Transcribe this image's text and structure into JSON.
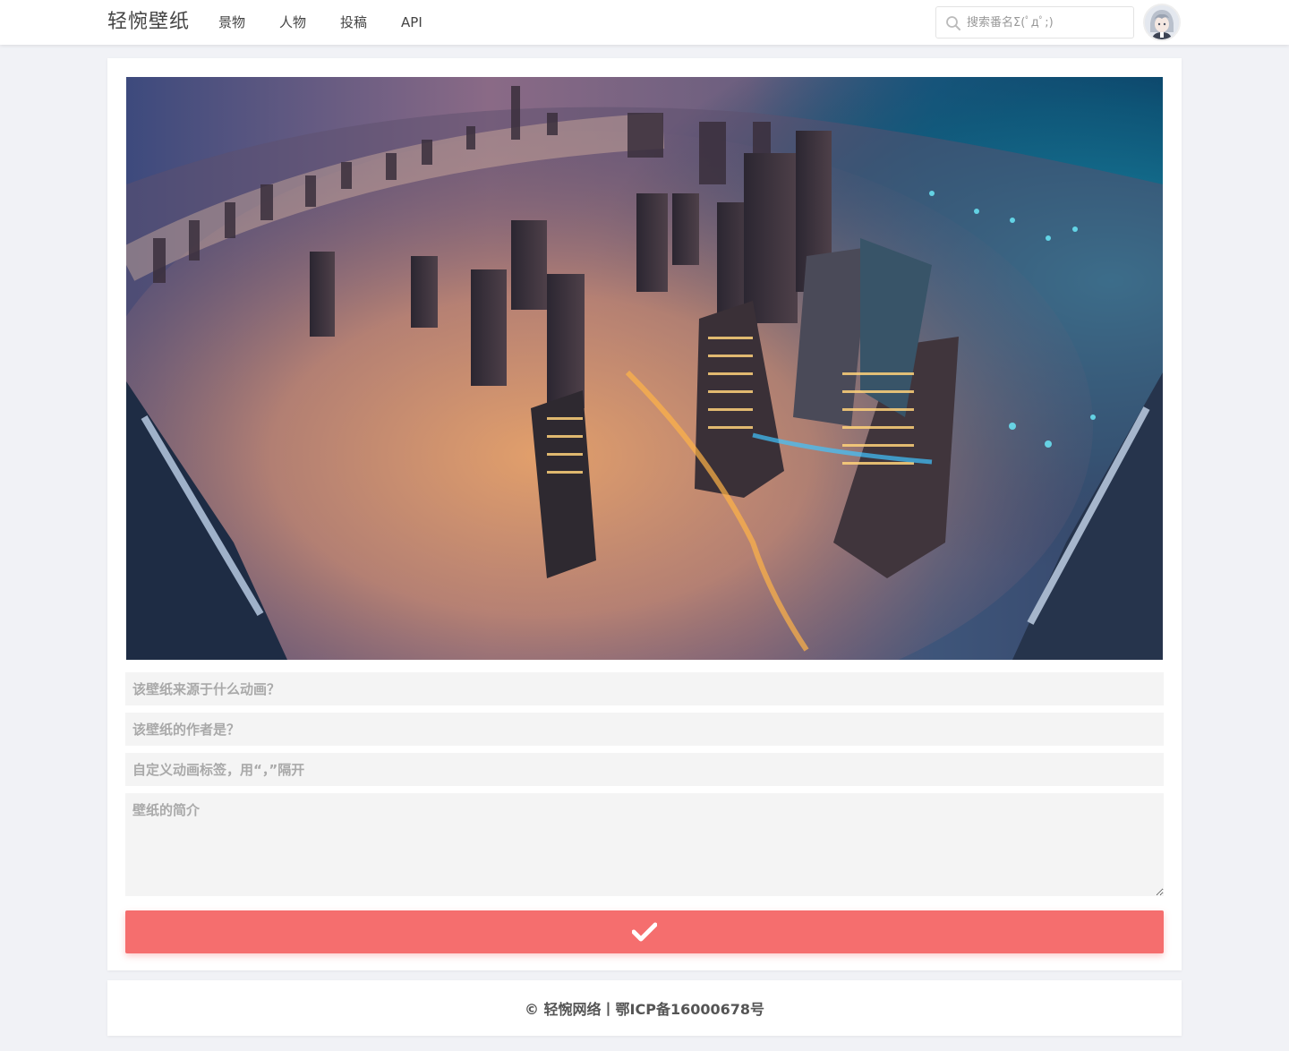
{
  "header": {
    "brand": "轻惋壁纸",
    "nav": [
      {
        "label": "景物"
      },
      {
        "label": "人物"
      },
      {
        "label": "投稿"
      },
      {
        "label": "API"
      }
    ],
    "search": {
      "placeholder": "搜索番名Σ(ﾟдﾟ;)"
    },
    "avatar_icon": "user-avatar"
  },
  "main": {
    "wallpaper_icon": "city-skyline-image",
    "fields": {
      "anime_placeholder": "该壁纸来源于什么动画？",
      "author_placeholder": "该壁纸的作者是？",
      "tags_placeholder": "自定义动画标签，用“，”隔开",
      "desc_placeholder": "壁纸的简介"
    },
    "submit_icon": "checkmark-icon",
    "submit_color": "#f56e6e"
  },
  "footer": {
    "text": "© 轻惋网络丨鄂ICP备16000678号"
  }
}
